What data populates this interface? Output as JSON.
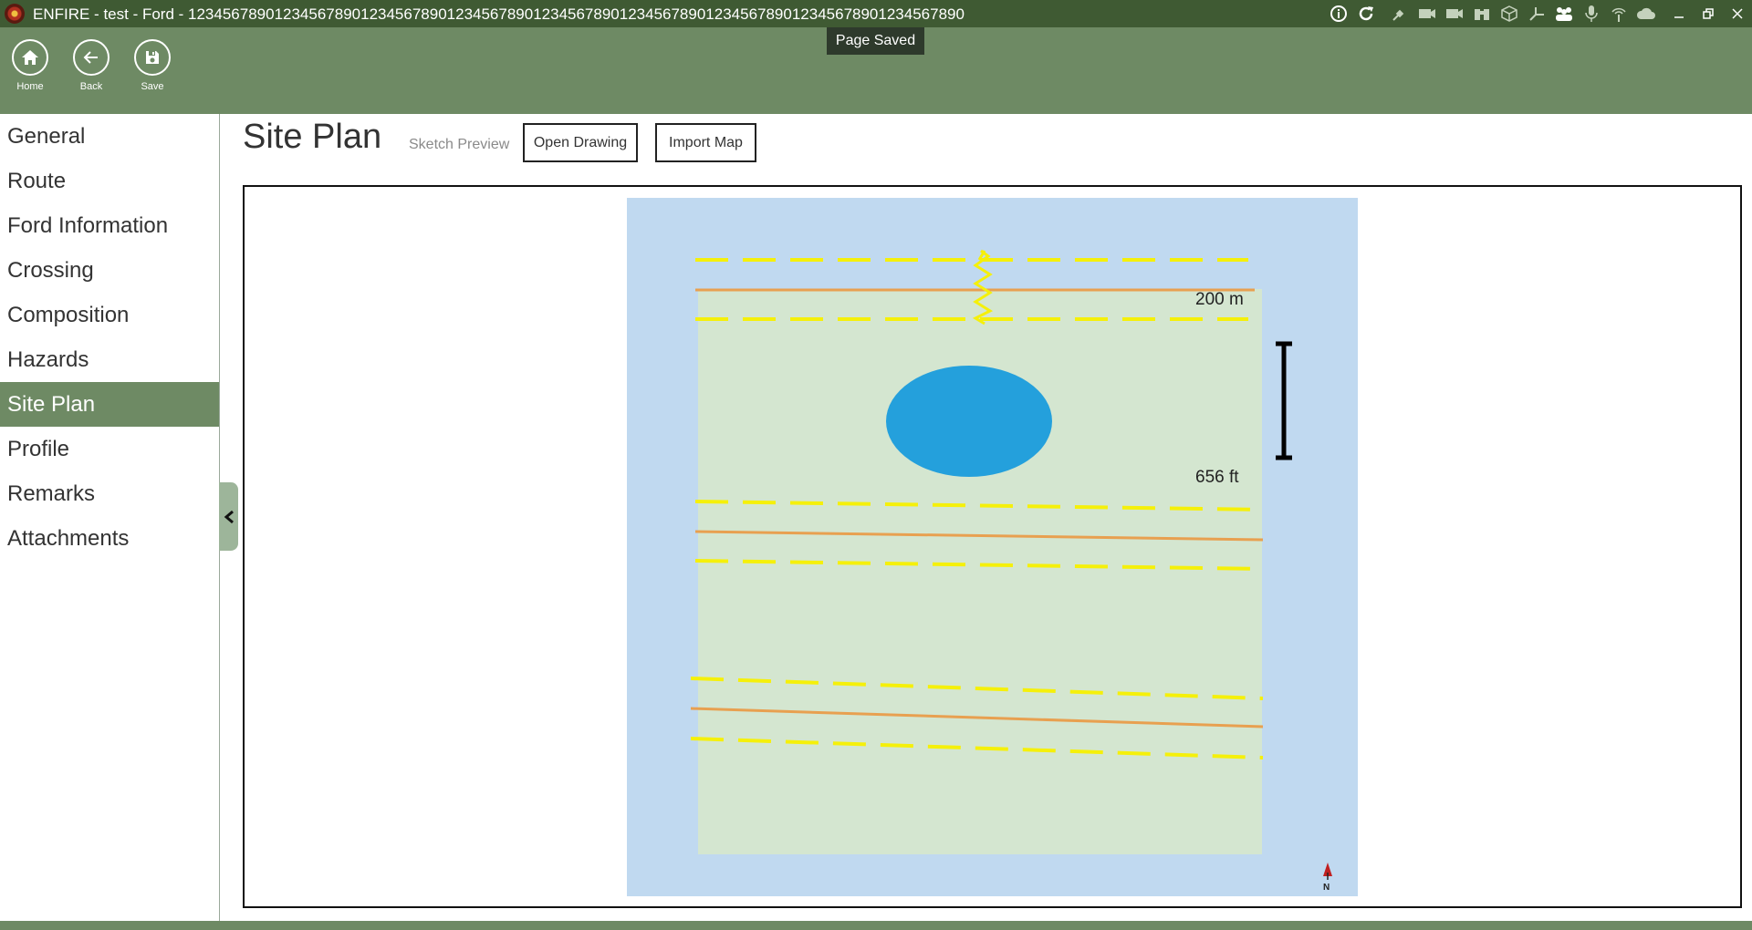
{
  "window": {
    "title": "ENFIRE - test - Ford - 123456789012345678901234567890123456789012345678901234567890123456789012345678901234567890"
  },
  "titlebar_icons": [
    "info-icon",
    "refresh-icon",
    "satellite-icon",
    "camera-icon",
    "video-icon",
    "binoculars-icon",
    "cube-icon",
    "axes-icon",
    "group-icon",
    "microphone-icon",
    "antenna-icon",
    "cloud-icon"
  ],
  "toolbar": {
    "home_label": "Home",
    "back_label": "Back",
    "save_label": "Save"
  },
  "toast": {
    "text": "Page Saved"
  },
  "sidebar": {
    "items": [
      {
        "label": "General",
        "active": false
      },
      {
        "label": "Route",
        "active": false
      },
      {
        "label": "Ford Information",
        "active": false
      },
      {
        "label": "Crossing",
        "active": false
      },
      {
        "label": "Composition",
        "active": false
      },
      {
        "label": "Hazards",
        "active": false
      },
      {
        "label": "Site Plan",
        "active": true
      },
      {
        "label": "Profile",
        "active": false
      },
      {
        "label": "Remarks",
        "active": false
      },
      {
        "label": "Attachments",
        "active": false
      }
    ]
  },
  "main": {
    "title": "Site Plan",
    "sketch_preview_label": "Sketch Preview",
    "open_drawing_label": "Open Drawing",
    "import_map_label": "Import Map"
  },
  "sketch": {
    "scale_metric": "200 m",
    "scale_imperial": "656 ft",
    "north_label": "N",
    "colors": {
      "water": "#c0d9f0",
      "land": "#d4e6d0",
      "pond": "#24a0dc",
      "road_center": "#e8a050",
      "road_edge": "#f5f00a",
      "scale_bar": "#000000",
      "accent": "#6e8a64",
      "title_bar": "#3f5a33"
    }
  }
}
